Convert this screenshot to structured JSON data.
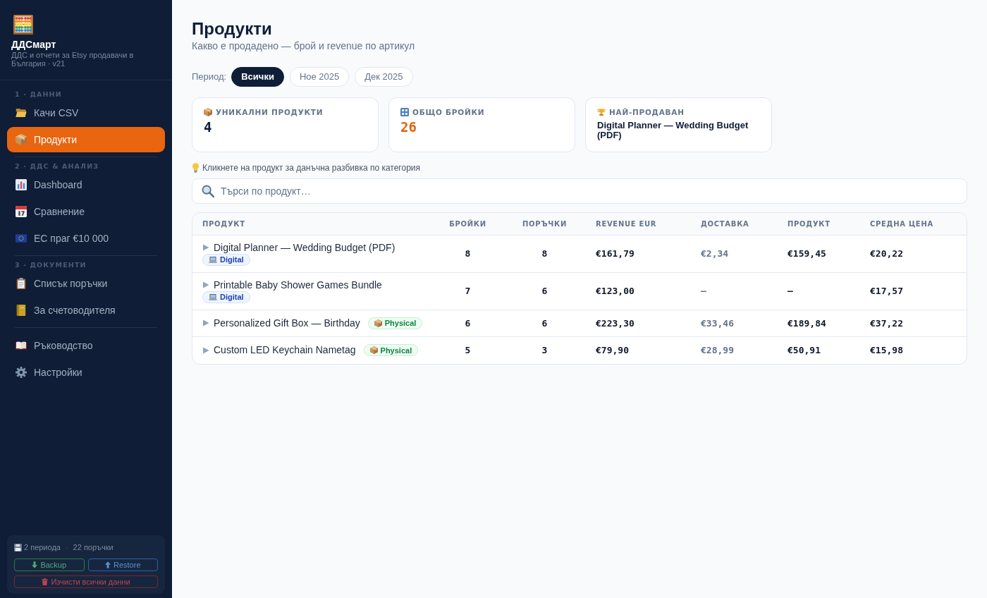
{
  "sidebar": {
    "app_title": "ДДСмарт",
    "app_subtitle": "ДДС и отчети за Etsy продавачи в България · v21",
    "sections": [
      {
        "label": "1 · ДАННИ",
        "items": [
          {
            "kind": "upload",
            "label": "Качи CSV",
            "selected": false
          },
          {
            "kind": "products",
            "label": "Продукти",
            "selected": true
          }
        ]
      },
      {
        "label": "2 · ДДС & АНАЛИЗ",
        "items": [
          {
            "kind": "dashboard",
            "label": "Dashboard",
            "selected": false
          },
          {
            "kind": "compare",
            "label": "Сравнение",
            "selected": false
          },
          {
            "kind": "eu",
            "label": "ЕС праг €10 000",
            "selected": false
          }
        ]
      },
      {
        "label": "3 · ДОКУМЕНТИ",
        "items": [
          {
            "kind": "orders",
            "label": "Списък поръчки",
            "selected": false
          },
          {
            "kind": "accountant",
            "label": "За счетоводителя",
            "selected": false
          }
        ]
      },
      {
        "items": [
          {
            "kind": "guide",
            "label": "Ръководство",
            "selected": false
          },
          {
            "kind": "settings",
            "label": "Настройки",
            "selected": false
          }
        ]
      }
    ],
    "storage": {
      "summary": [
        "2 периода",
        "22 поръчки"
      ],
      "separator": "·",
      "buttons": [
        {
          "kind": "backup",
          "label": "Backup"
        },
        {
          "kind": "restore",
          "label": "Restore"
        },
        {
          "kind": "clear",
          "label": "Изчисти всички данни"
        }
      ]
    }
  },
  "page": {
    "title": "Продукти",
    "subtitle": "Какво е продадено — брой и revenue по артикул"
  },
  "period": {
    "label": "Период:",
    "options": [
      {
        "label": "Всички",
        "selected": true
      },
      {
        "label": "Ное 2025",
        "selected": false
      },
      {
        "label": "Дек 2025",
        "selected": false
      }
    ]
  },
  "stats": [
    {
      "kind": "unique",
      "label": "УНИКАЛНИ ПРОДУКТИ",
      "value": "4"
    },
    {
      "kind": "total",
      "label": "ОБЩО БРОЙКИ",
      "value": "26"
    },
    {
      "kind": "best",
      "label": "НАЙ-ПРОДАВАН",
      "value": "Digital Planner — Wedding Budget (PDF)"
    }
  ],
  "hint": "Кликнете на продукт за данъчна разбивка по категория",
  "search": {
    "placeholder": "Търси по продукт…"
  },
  "table": {
    "columns": [
      {
        "kind": "product",
        "label": "ПРОДУКТ"
      },
      {
        "kind": "count",
        "label": "БРОЙКИ"
      },
      {
        "kind": "count",
        "label": "ПОРЪЧКИ"
      },
      {
        "kind": "amount",
        "label": "REVENUE EUR"
      },
      {
        "kind": "muted_amount",
        "label": "ДОСТАВКА"
      },
      {
        "kind": "amount",
        "label": "ПРОДУКТ"
      },
      {
        "kind": "amount",
        "label": "СРЕДНА ЦЕНА"
      }
    ],
    "rows": [
      {
        "expanded": false,
        "badge": {
          "kind": "digital",
          "label": "Digital"
        },
        "cells": [
          "Digital Planner — Wedding Budget (PDF)",
          "8",
          "8",
          "€161,79",
          "€2,34",
          "€159,45",
          "€20,22"
        ]
      },
      {
        "expanded": false,
        "badge": {
          "kind": "digital",
          "label": "Digital"
        },
        "cells": [
          "Printable Baby Shower Games Bundle",
          "7",
          "6",
          "€123,00",
          "—",
          "—",
          "€17,57"
        ]
      },
      {
        "expanded": false,
        "badge": {
          "kind": "physical",
          "label": "Physical"
        },
        "cells": [
          "Personalized Gift Box — Birthday",
          "6",
          "6",
          "€223,30",
          "€33,46",
          "€189,84",
          "€37,22"
        ]
      },
      {
        "expanded": false,
        "badge": {
          "kind": "physical",
          "label": "Physical"
        },
        "cells": [
          "Custom LED Keychain Nametag",
          "5",
          "3",
          "€79,90",
          "€28,99",
          "€50,91",
          "€15,98"
        ]
      }
    ]
  }
}
